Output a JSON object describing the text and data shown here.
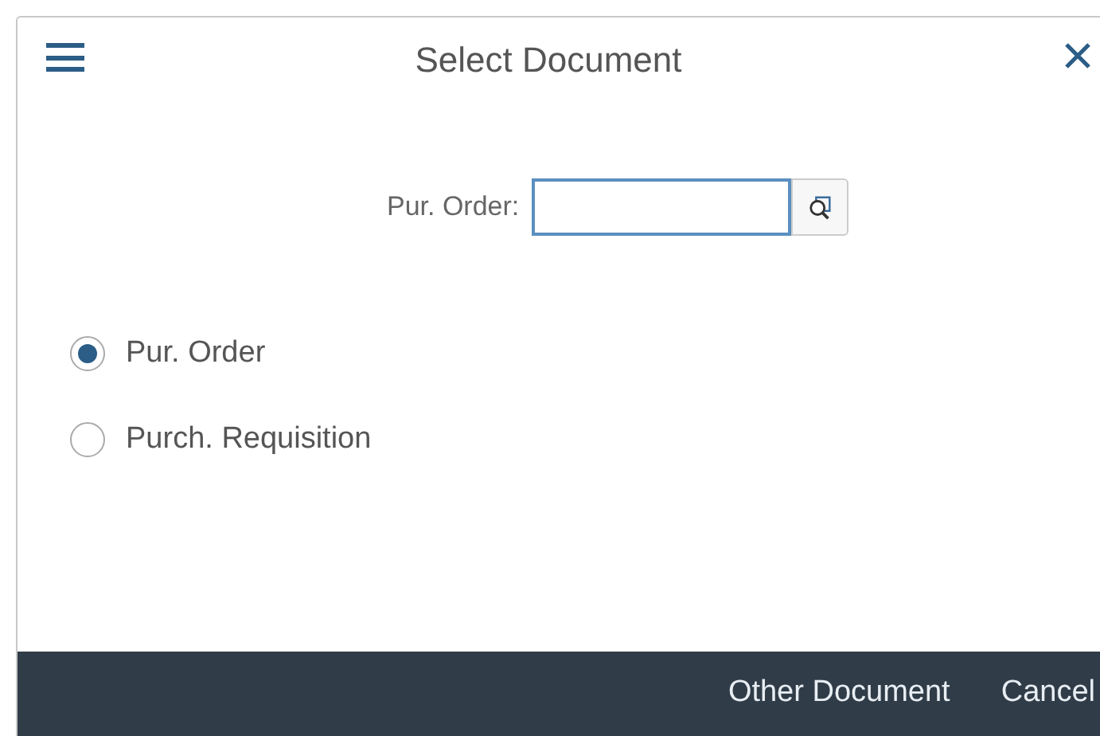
{
  "dialog": {
    "title": "Select Document"
  },
  "field": {
    "label": "Pur. Order:"
  },
  "options": [
    {
      "label": "Pur. Order",
      "selected": true
    },
    {
      "label": "Purch. Requisition",
      "selected": false
    }
  ],
  "footer_buttons": [
    "Other Document",
    "Cancel"
  ]
}
